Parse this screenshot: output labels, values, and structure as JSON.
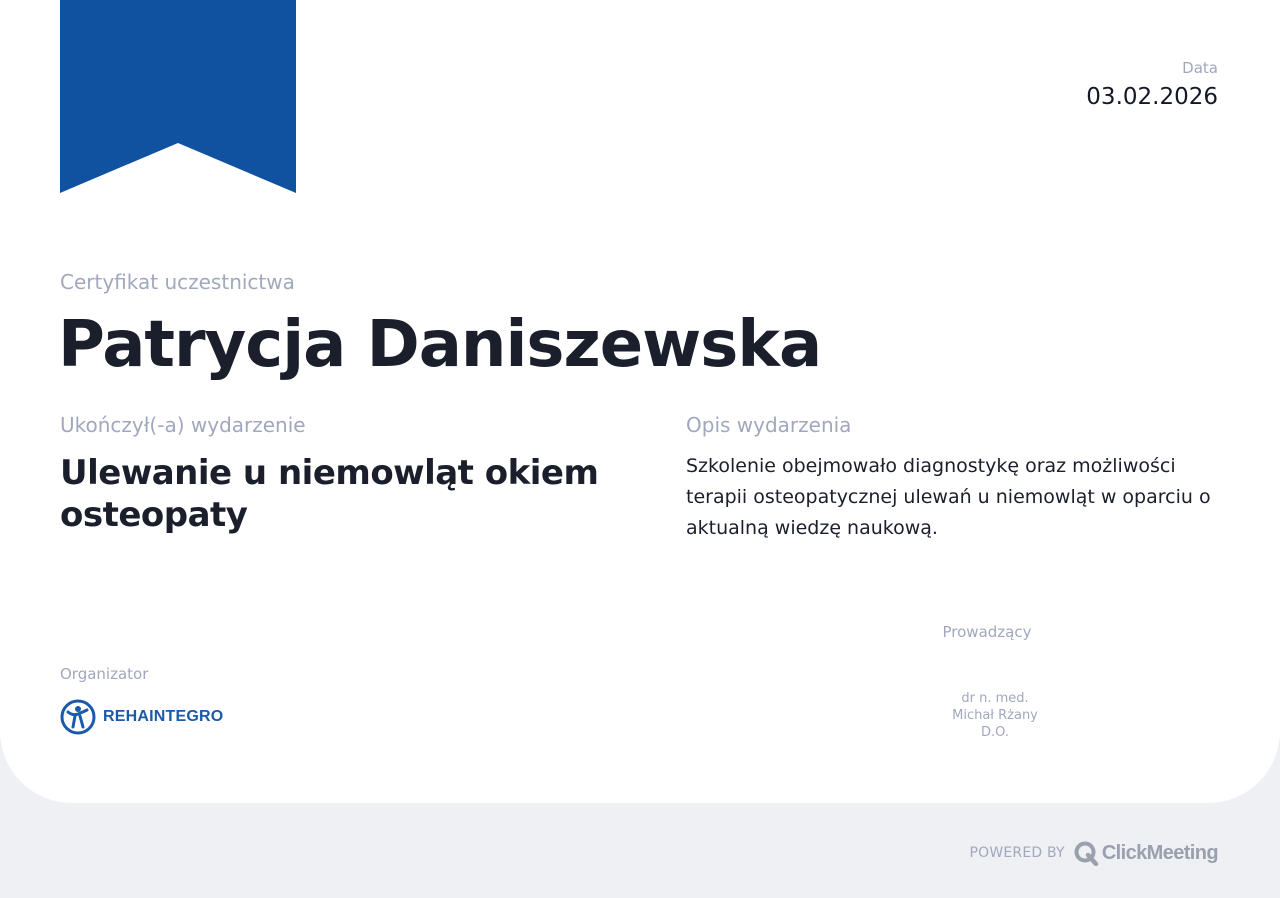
{
  "certificate": {
    "date_label": "Data",
    "date_value": "03.02.2026",
    "cert_label": "Certyfikat uczestnictwa",
    "participant_name": "Patrycja Daniszewska",
    "completed_label": "Ukończył(-a) wydarzenie",
    "event_title": "Ulewanie u niemowląt okiem osteopaty",
    "description_label": "Opis wydarzenia",
    "description_text": "Szkolenie obejmowało diagnostykę oraz możliwości terapii osteopatycznej ulewań u niemowląt w oparciu o aktualną wiedzę naukową."
  },
  "organizer": {
    "label": "Organizator",
    "logo_text": "REHAINTEGRO",
    "logo_icon": "person-circle-icon"
  },
  "host": {
    "label": "Prowadzący",
    "name_lines": [
      "dr n. med.",
      "Michał Rżany",
      "D.O."
    ]
  },
  "footer": {
    "powered_label": "POWERED BY",
    "brand_name": "ClickMeeting",
    "brand_icon": "clickmeeting-q-icon"
  },
  "colors": {
    "ribbon": "#10529f",
    "accent": "#1a5aa8",
    "muted_text": "#a1a8bd",
    "dark_text": "#1b1f2c",
    "background": "#eff0f4",
    "card": "#ffffff"
  }
}
